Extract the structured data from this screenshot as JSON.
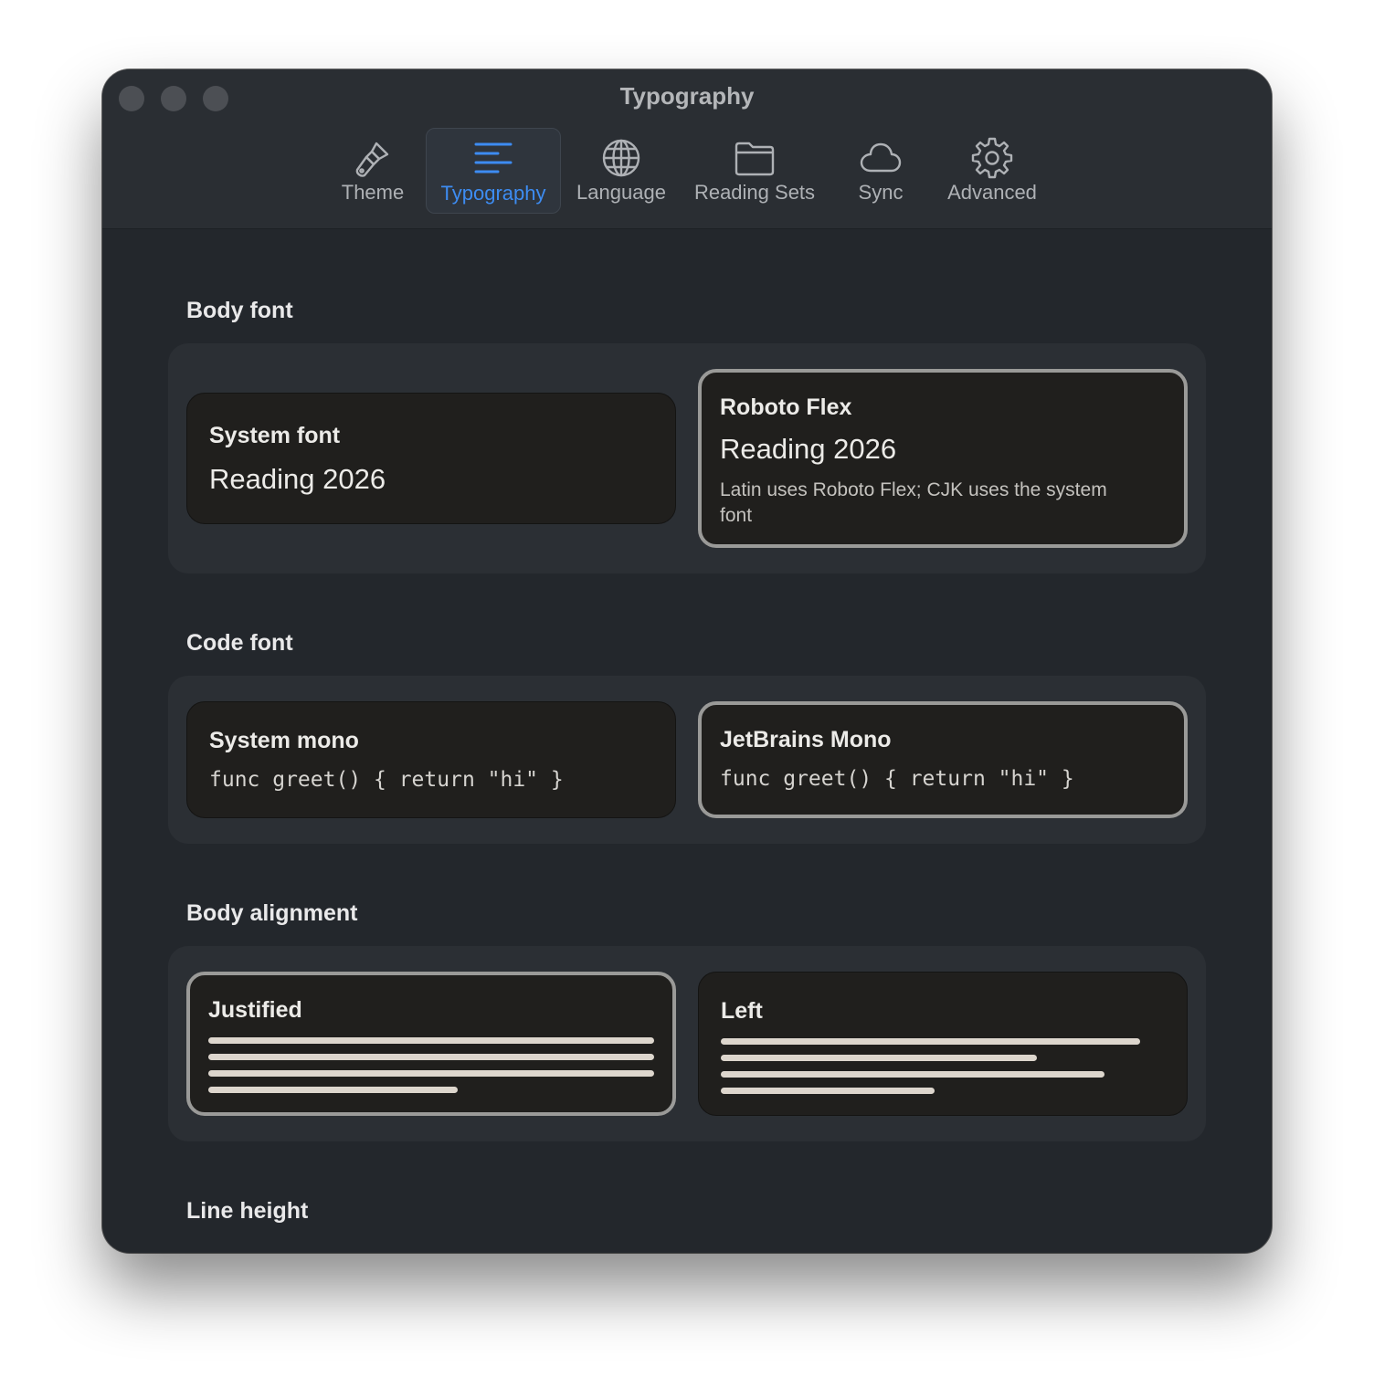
{
  "window": {
    "title": "Typography"
  },
  "toolbar": {
    "tabs": [
      {
        "label": "Theme",
        "icon": "paintbrush-icon"
      },
      {
        "label": "Typography",
        "icon": "text-align-icon",
        "active": true
      },
      {
        "label": "Language",
        "icon": "globe-icon"
      },
      {
        "label": "Reading Sets",
        "icon": "folder-icon"
      },
      {
        "label": "Sync",
        "icon": "cloud-icon"
      },
      {
        "label": "Advanced",
        "icon": "gear-icon"
      }
    ]
  },
  "sections": {
    "body_font": {
      "title": "Body font",
      "options": [
        {
          "name": "System font",
          "sample": "Reading 2026",
          "note": "",
          "selected": false
        },
        {
          "name": "Roboto Flex",
          "sample": "Reading 2026",
          "note": "Latin uses Roboto Flex; CJK uses the system font",
          "selected": true
        }
      ]
    },
    "code_font": {
      "title": "Code font",
      "options": [
        {
          "name": "System mono",
          "sample": "func greet() { return \"hi\" }",
          "selected": false
        },
        {
          "name": "JetBrains Mono",
          "sample": "func greet() { return \"hi\" }",
          "selected": true
        }
      ]
    },
    "body_alignment": {
      "title": "Body alignment",
      "options": [
        {
          "name": "Justified",
          "selected": true
        },
        {
          "name": "Left",
          "selected": false
        }
      ]
    },
    "line_height": {
      "title": "Line height"
    }
  },
  "colors": {
    "accent": "#3d8cf2",
    "window_bg": "#23272c",
    "card_bg": "#201f1d",
    "selected_border": "#9a9a98",
    "preview_line": "#ddd6cd"
  }
}
